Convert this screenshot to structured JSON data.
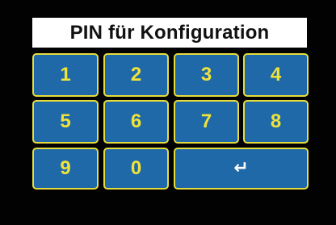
{
  "colors": {
    "background": "#020202",
    "title_bg": "#ffffff",
    "title_text": "#111111",
    "key_fill": "#1f69a8",
    "key_border": "#e8dc3c",
    "key_text": "#f0e23a",
    "enter_icon": "#ffffff"
  },
  "title": "PIN für Konfiguration",
  "keypad": {
    "keys": [
      "1",
      "2",
      "3",
      "4",
      "5",
      "6",
      "7",
      "8",
      "9",
      "0"
    ],
    "enter_icon": "enter-icon",
    "enter_glyph": "↵"
  }
}
